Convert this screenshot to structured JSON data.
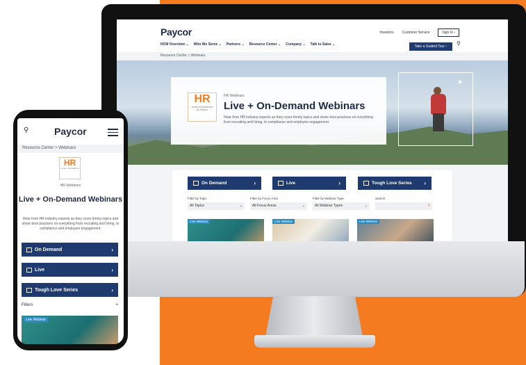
{
  "desktop": {
    "logo": "Paycor",
    "top_links": [
      "Investors",
      "Customer Service"
    ],
    "sign_in": "Sign In",
    "nav": [
      "HCM Overview ⌄",
      "Who We Serve ⌄",
      "Partners ⌄",
      "Resource Center ⌄",
      "Company ⌄",
      "Talk to Sales ⌄"
    ],
    "tour_button": "Take a Guided Tour",
    "breadcrumb": "Resource Center > Webinars",
    "hero": {
      "badge_hr": "HR",
      "badge_small": "center of excellence",
      "badge_by": "by Paycor",
      "eyebrow": "HR Webinars",
      "title": "Live + On-Demand Webinars",
      "description": "Hear from HR industry experts as they cover timely topics and share best practices on everything from recruiting and hiring, to compliance and employee engagement."
    },
    "buttons": [
      "On Demand",
      "Live",
      "Tough Love Series"
    ],
    "filters": [
      {
        "label": "Filter by Topic",
        "value": "All Topics"
      },
      {
        "label": "Filter by Focus Area",
        "value": "All Focus Areas"
      },
      {
        "label": "Filter by Webinar Type",
        "value": "All Webinar Types"
      }
    ],
    "search_label": "Search",
    "card_tag": "Live Webinar"
  },
  "phone": {
    "logo": "Paycor",
    "breadcrumb": "Resource Center > Webinars",
    "badge_hr": "HR",
    "badge_small": "center of excellence",
    "eyebrow": "HR Webinars",
    "title": "Live + On-Demand Webinars",
    "description": "Hear from HR industry experts as they cover timely topics and share best practices on everything from recruiting and hiring, to compliance and employee engagement.",
    "buttons": [
      "On Demand",
      "Live",
      "Tough Love Series"
    ],
    "filters_label": "Filters",
    "card_tag": "Live Webinar"
  },
  "colors": {
    "accent": "#f47b20",
    "navy": "#1f3a6e"
  }
}
